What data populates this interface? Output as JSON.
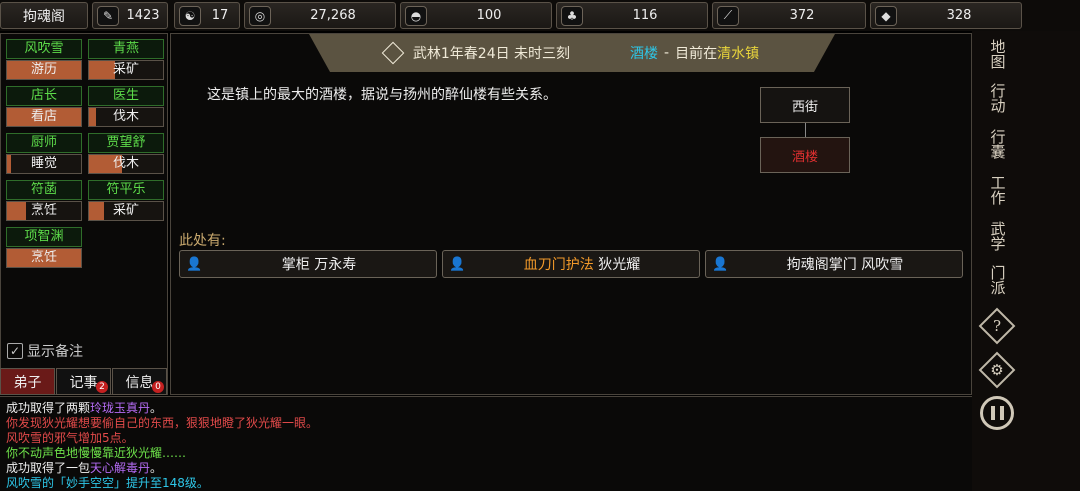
{
  "top": {
    "sect": "拘魂阁",
    "resources": [
      {
        "icon": "fame-icon",
        "value": "1423"
      },
      {
        "icon": "yinyang-icon",
        "value": "17"
      },
      {
        "icon": "coin-icon",
        "value": "27,268"
      },
      {
        "icon": "food-icon",
        "value": "100"
      },
      {
        "icon": "herb-icon",
        "value": "116"
      },
      {
        "icon": "wood-icon",
        "value": "372"
      },
      {
        "icon": "ore-icon",
        "value": "328"
      }
    ]
  },
  "disciples": [
    {
      "name": "风吹雪",
      "action": "游历",
      "progress": 1.0
    },
    {
      "name": "青燕",
      "action": "采矿",
      "progress": 0.35
    },
    {
      "name": "店长",
      "action": "看店",
      "progress": 1.0
    },
    {
      "name": "医生",
      "action": "伐木",
      "progress": 0.1
    },
    {
      "name": "厨师",
      "action": "睡觉",
      "progress": 0.05
    },
    {
      "name": "贾望舒",
      "action": "伐木",
      "progress": 0.45
    },
    {
      "name": "符菡",
      "action": "烹饪",
      "progress": 0.25
    },
    {
      "name": "符平乐",
      "action": "采矿",
      "progress": 0.2
    },
    {
      "name": "项智渊",
      "action": "烹饪",
      "progress": 1.0
    }
  ],
  "left": {
    "memo_label": "显示备注",
    "tabs": [
      {
        "label": "弟子",
        "badge": ""
      },
      {
        "label": "记事",
        "badge": "2"
      },
      {
        "label": "信息",
        "badge": "0"
      }
    ]
  },
  "header": {
    "date": "武林1年春24日 未时三刻",
    "place": "酒楼",
    "sep": "-",
    "current_prefix": "目前在",
    "town": "清水镇"
  },
  "location": {
    "description": "这是镇上的最大的酒楼，据说与扬州的醉仙楼有些关系。",
    "map_nodes": [
      "西街",
      "酒楼"
    ],
    "here_label": "此处有:"
  },
  "npcs": [
    {
      "faction": "",
      "role": "掌柜",
      "name": "万永寿"
    },
    {
      "faction": "血刀门护法",
      "role": "",
      "name": "狄光耀"
    },
    {
      "faction": "",
      "role": "拘魂阁掌门",
      "name": "风吹雪"
    }
  ],
  "sidebar": [
    "地图",
    "行动",
    "行囊",
    "工作",
    "武学",
    "门派",
    "?",
    "⚙"
  ],
  "log": [
    [
      {
        "t": "成功取得了两颗",
        "c": "white"
      },
      {
        "t": "玲珑玉真丹",
        "c": "purple"
      },
      {
        "t": "。",
        "c": "white"
      }
    ],
    [
      {
        "t": "你发现狄光耀想要偷自己的东西，狠狠地瞪了狄光耀一眼。",
        "c": "red"
      }
    ],
    [
      {
        "t": "风吹雪的邪气增加5点。",
        "c": "red"
      }
    ],
    [
      {
        "t": "你不动声色地慢慢靠近狄光耀……",
        "c": "lime"
      }
    ],
    [
      {
        "t": "成功取得了一包",
        "c": "white"
      },
      {
        "t": "天心解毒丹",
        "c": "purple"
      },
      {
        "t": "。",
        "c": "white"
      }
    ],
    [
      {
        "t": "风吹雪的「妙手空空」提升至148级。",
        "c": "teal"
      }
    ]
  ]
}
